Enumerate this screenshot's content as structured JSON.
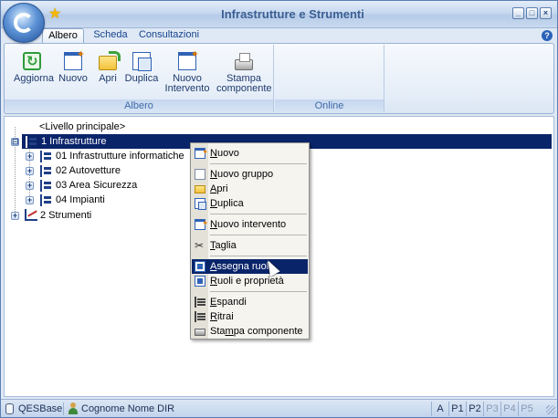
{
  "window": {
    "title": "Infrastrutture e Strumenti",
    "min_glyph": "_",
    "max_glyph": "□",
    "close_glyph": "×"
  },
  "quick_access": {
    "star_icon": "star-icon",
    "star_glyph": "★"
  },
  "ribbon": {
    "tabs": [
      {
        "label": "Albero",
        "active": true
      },
      {
        "label": "Scheda",
        "active": false
      },
      {
        "label": "Consultazioni",
        "active": false
      }
    ],
    "help_glyph": "?",
    "groups": {
      "albero": {
        "label": "Albero",
        "buttons": [
          {
            "label": "Aggiorna",
            "icon": "refresh-icon"
          },
          {
            "label": "Nuovo",
            "icon": "new-document-icon"
          },
          {
            "label": "Apri",
            "icon": "open-folder-icon"
          },
          {
            "label": "Duplica",
            "icon": "duplicate-icon"
          },
          {
            "label_line1": "Nuovo",
            "label_line2": "Intervento",
            "icon": "new-intervention-icon"
          },
          {
            "label_line1": "Stampa",
            "label_line2": "componente",
            "icon": "printer-icon"
          }
        ]
      },
      "online": {
        "label": "Online"
      }
    }
  },
  "tree": {
    "root_label": "<Livello principale>",
    "nodes": [
      {
        "label": "1 Infrastrutture",
        "selected": true,
        "expander": "⊟"
      },
      {
        "label": "01 Infrastrutture informatiche",
        "expander": "+"
      },
      {
        "label": "02 Autovetture",
        "expander": "+"
      },
      {
        "label": "03 Area Sicurezza",
        "expander": "+"
      },
      {
        "label": "04 Impianti",
        "expander": "+"
      },
      {
        "label": "2 Strumenti",
        "expander": "+"
      }
    ]
  },
  "context_menu": {
    "items": [
      {
        "pre": "",
        "u": "N",
        "post": "uovo",
        "icon": "new-document-icon"
      },
      {
        "pre": "",
        "u": "N",
        "post": "uovo gruppo",
        "icon": "page-icon"
      },
      {
        "pre": "",
        "u": "A",
        "post": "pri",
        "icon": "open-folder-icon"
      },
      {
        "pre": "",
        "u": "D",
        "post": "uplica",
        "icon": "duplicate-icon"
      },
      {
        "pre": "",
        "u": "N",
        "post": "uovo intervento",
        "icon": "new-intervention-icon"
      },
      {
        "pre": "",
        "u": "T",
        "post": "aglia",
        "icon": "scissors-icon",
        "glyph": "✂"
      },
      {
        "pre": "",
        "u": "A",
        "post": "ssegna ruoli",
        "icon": "assign-roles-icon",
        "highlighted": true
      },
      {
        "pre": "",
        "u": "R",
        "post": "uoli e proprietà",
        "icon": "roles-properties-icon"
      },
      {
        "pre": "",
        "u": "E",
        "post": "spandi",
        "icon": "expand-tree-icon"
      },
      {
        "pre": "",
        "u": "R",
        "post": "itrai",
        "icon": "collapse-tree-icon"
      },
      {
        "pre": "Sta",
        "u": "m",
        "post": "pa componente",
        "icon": "printer-icon"
      }
    ]
  },
  "statusbar": {
    "database": "QESBase",
    "user": "Cognome Nome DIR",
    "cells": [
      {
        "label": "A",
        "enabled": true
      },
      {
        "label": "P1",
        "enabled": true
      },
      {
        "label": "P2",
        "enabled": true
      },
      {
        "label": "P3",
        "enabled": false
      },
      {
        "label": "P4",
        "enabled": false
      },
      {
        "label": "P5",
        "enabled": false
      }
    ]
  }
}
